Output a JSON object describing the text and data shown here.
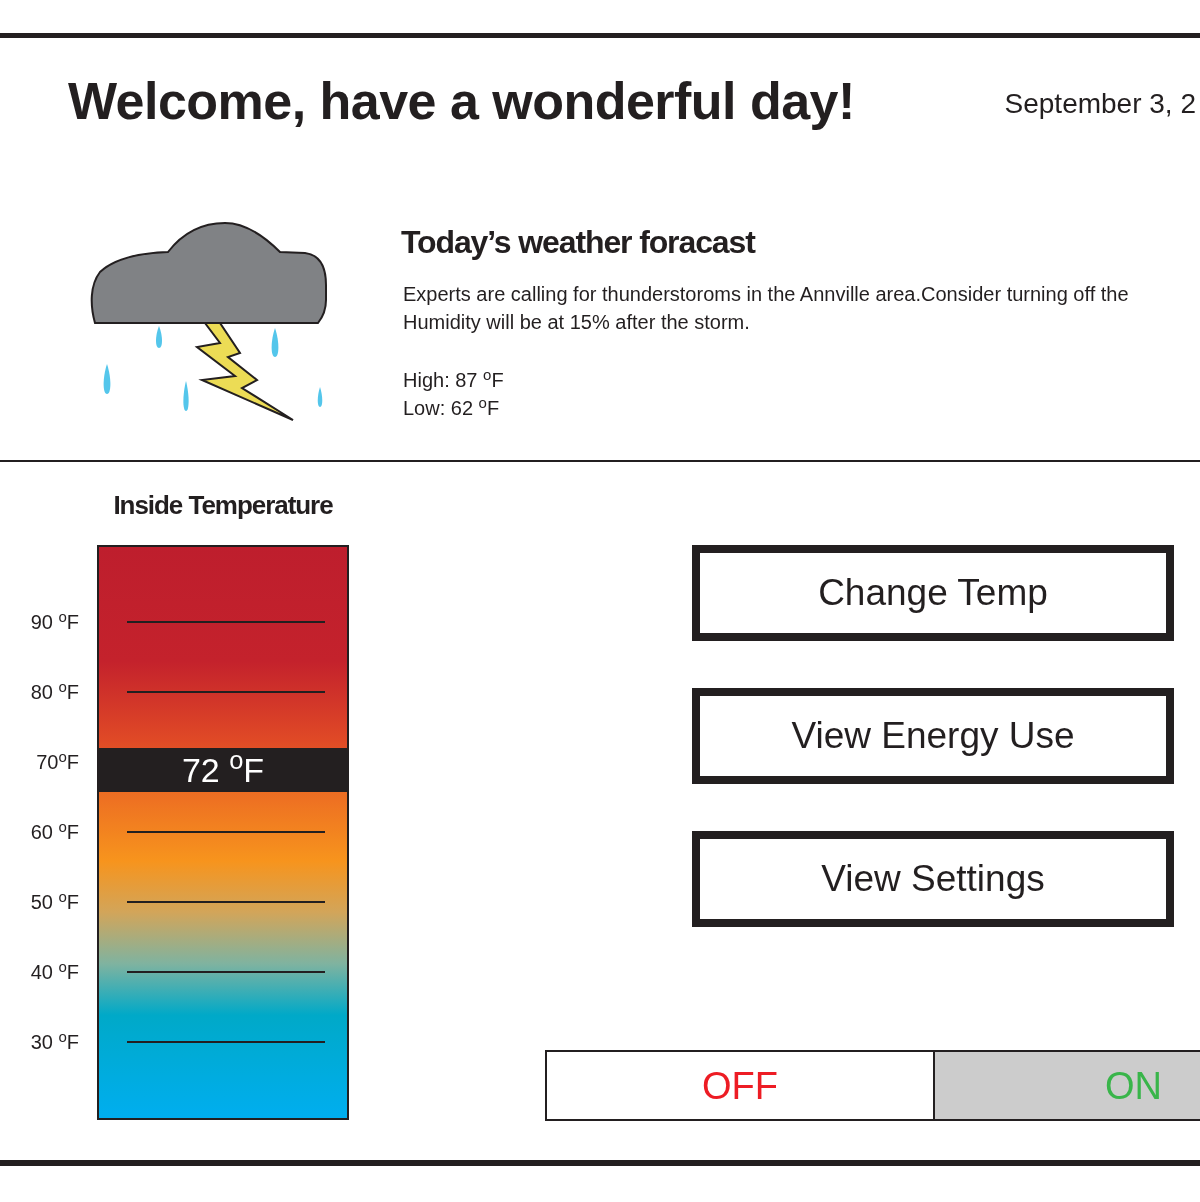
{
  "header": {
    "title": "Welcome, have a wonderful day!",
    "date": "September 3, 2"
  },
  "weather": {
    "heading": "Today’s weather foracast",
    "lines": [
      "Experts are calling for thunderstoroms in the Annville area.Consider turning off the",
      "Humidity will be at 15% after the storm."
    ],
    "high": "High: 87 $^{o}$F",
    "low": "Low: 62 $^{o}$F"
  },
  "thermometer": {
    "title": "Inside Temperature",
    "scale": [
      "90 $^{o}$F",
      "80 $^{o}$F",
      "70$^{o}$F",
      "60 $^{o}$F",
      "50 $^{o}$F",
      "40 $^{o}$F",
      "30 $^{o}$F"
    ],
    "reading": "72 $^{o}$F",
    "level": 0.61
  },
  "buttons": [
    {
      "label": "Change Temp"
    },
    {
      "label": "View Energy Use"
    },
    {
      "label": "View Settings"
    }
  ],
  "toggle": {
    "options": [
      {
        "label": "OFF",
        "selected": false,
        "color": "#ed1c24"
      },
      {
        "label": "ON",
        "selected": true,
        "color": "#39b54a"
      }
    ]
  }
}
